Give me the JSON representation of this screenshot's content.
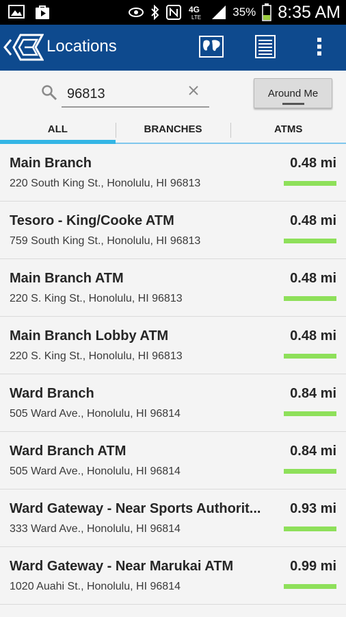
{
  "status_bar": {
    "battery": "35%",
    "time": "8:35 AM",
    "network": "4G LTE",
    "icons": [
      "gallery-icon",
      "play-store-icon",
      "eye-icon",
      "bluetooth-icon",
      "nfc-icon",
      "signal-icon",
      "battery-icon"
    ]
  },
  "app_bar": {
    "title": "Locations",
    "accent": "#0e4a8e",
    "actions": [
      "map-icon",
      "list-icon",
      "overflow-menu-icon"
    ]
  },
  "search": {
    "value": "96813",
    "around_me_label": "Around Me"
  },
  "tabs": [
    {
      "label": "ALL",
      "active": true
    },
    {
      "label": "BRANCHES",
      "active": false
    },
    {
      "label": "ATMS",
      "active": false
    }
  ],
  "locations": [
    {
      "name": "Main Branch",
      "address": "220 South King St., Honolulu, HI 96813",
      "distance": "0.48 mi"
    },
    {
      "name": "Tesoro - King/Cooke ATM",
      "address": "759 South King St., Honolulu, HI 96813",
      "distance": "0.48 mi"
    },
    {
      "name": "Main Branch ATM",
      "address": "220 S. King St., Honolulu, HI 96813",
      "distance": "0.48 mi"
    },
    {
      "name": "Main Branch Lobby ATM",
      "address": "220 S. King St., Honolulu, HI 96813",
      "distance": "0.48 mi"
    },
    {
      "name": "Ward Branch",
      "address": "505 Ward Ave., Honolulu, HI 96814",
      "distance": "0.84 mi"
    },
    {
      "name": "Ward Branch ATM",
      "address": "505 Ward Ave., Honolulu, HI 96814",
      "distance": "0.84 mi"
    },
    {
      "name": "Ward Gateway - Near Sports Authorit...",
      "address": "333 Ward Ave., Honolulu, HI 96814",
      "distance": "0.93 mi"
    },
    {
      "name": "Ward Gateway - Near Marukai ATM",
      "address": "1020 Auahi St., Honolulu, HI 96814",
      "distance": "0.99 mi"
    }
  ],
  "distance_bar_color": "#8ee05a"
}
